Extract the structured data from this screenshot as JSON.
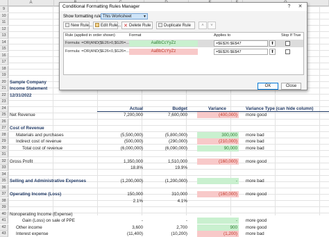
{
  "sheet": {
    "columns": [
      "A",
      "B",
      "C",
      "D",
      "E",
      "F",
      "G"
    ],
    "rows": [
      {
        "num": "9",
        "cells": []
      },
      {
        "num": "10",
        "cells": []
      },
      {
        "num": "11",
        "cells": []
      },
      {
        "num": "12",
        "cells": []
      },
      {
        "num": "13",
        "cells": []
      },
      {
        "num": "14",
        "cells": []
      },
      {
        "num": "15",
        "cells": []
      },
      {
        "num": "16",
        "cells": []
      },
      {
        "num": "17",
        "cells": []
      },
      {
        "num": "18",
        "cells": []
      },
      {
        "num": "19",
        "cells": []
      },
      {
        "num": "20",
        "cells": [
          {
            "text": "Sample Company",
            "bold": true
          }
        ]
      },
      {
        "num": "21",
        "cells": [
          {
            "text": "Income Statement",
            "bold": true
          }
        ]
      },
      {
        "num": "22",
        "cells": [
          {
            "text": "12/31/2022",
            "bold": true
          }
        ]
      },
      {
        "num": "23",
        "cells": []
      },
      {
        "num": "24",
        "cells": [
          {
            "col": "actual",
            "text": "Actual",
            "head": true
          },
          {
            "col": "budget",
            "text": "Budget",
            "head": true
          },
          {
            "col": "variance",
            "text": "Variance",
            "head": true
          },
          {
            "col": "vtype",
            "text": "Variance Type (can hide column)",
            "head": true
          }
        ]
      },
      {
        "num": "25",
        "cells": [
          {
            "text": "Net Revenue"
          },
          {
            "col": "actual",
            "text": "7,200,000"
          },
          {
            "col": "budget",
            "text": "7,600,000"
          },
          {
            "col": "variance",
            "text": "(400,000)",
            "fill": "red"
          },
          {
            "col": "vtype",
            "text": "more good"
          }
        ]
      },
      {
        "num": "26",
        "cells": []
      },
      {
        "num": "27",
        "cells": [
          {
            "text": "Cost of Revenue",
            "bold": true
          }
        ]
      },
      {
        "num": "28",
        "cells": [
          {
            "indent": 1,
            "text": "Materials and purchases"
          },
          {
            "col": "actual",
            "text": "(5,500,000)"
          },
          {
            "col": "budget",
            "text": "(5,800,000)"
          },
          {
            "col": "variance",
            "text": "300,000",
            "fill": "green"
          },
          {
            "col": "vtype",
            "text": "more bad"
          }
        ]
      },
      {
        "num": "29",
        "cells": [
          {
            "indent": 1,
            "text": "Indirect cost of revenue"
          },
          {
            "col": "actual",
            "text": "(500,000)"
          },
          {
            "col": "budget",
            "text": "(290,000)"
          },
          {
            "col": "variance",
            "text": "(210,000)",
            "fill": "red"
          },
          {
            "col": "vtype",
            "text": "more bad"
          }
        ]
      },
      {
        "num": "30",
        "cells": [
          {
            "indent": 2,
            "text": "Total cost of revenue"
          },
          {
            "col": "actual",
            "text": "(6,000,000)"
          },
          {
            "col": "budget",
            "text": "(6,090,000)"
          },
          {
            "col": "variance",
            "text": "90,000",
            "fill": "green"
          },
          {
            "col": "vtype",
            "text": "more bad"
          }
        ]
      },
      {
        "num": "31",
        "cells": []
      },
      {
        "num": "32",
        "cells": [
          {
            "text": "Gross Profit"
          },
          {
            "col": "actual",
            "text": "1,350,000"
          },
          {
            "col": "budget",
            "text": "1,510,000"
          },
          {
            "col": "variance",
            "text": "(160,000)",
            "fill": "red"
          },
          {
            "col": "vtype",
            "text": "more good"
          }
        ]
      },
      {
        "num": "33",
        "cells": [
          {
            "col": "actual",
            "text": "18.8%"
          },
          {
            "col": "budget",
            "text": "19.9%"
          }
        ]
      },
      {
        "num": "34",
        "cells": []
      },
      {
        "num": "35",
        "cells": [
          {
            "text": "Selling and Administrative Expenses",
            "bold": true
          },
          {
            "col": "actual",
            "text": "(1,200,000)"
          },
          {
            "col": "budget",
            "text": "(1,200,000)"
          },
          {
            "col": "variance",
            "text": "-",
            "fill": "green"
          },
          {
            "col": "vtype",
            "text": "more bad"
          }
        ]
      },
      {
        "num": "36",
        "cells": []
      },
      {
        "num": "37",
        "cells": [
          {
            "text": "Operating Income (Loss)",
            "bold": true
          },
          {
            "col": "actual",
            "text": "150,000"
          },
          {
            "col": "budget",
            "text": "310,000"
          },
          {
            "col": "variance",
            "text": "(160,000)",
            "fill": "red"
          },
          {
            "col": "vtype",
            "text": "more good"
          }
        ]
      },
      {
        "num": "38",
        "cells": [
          {
            "col": "actual",
            "text": "2.1%"
          },
          {
            "col": "budget",
            "text": "4.1%"
          }
        ]
      },
      {
        "num": "39",
        "cells": []
      },
      {
        "num": "40",
        "cells": [
          {
            "text": "Nonoperating Income (Expense)"
          }
        ]
      },
      {
        "num": "41",
        "cells": [
          {
            "indent": 2,
            "text": "Gain (Loss) on sale of PPE"
          },
          {
            "col": "actual",
            "text": "-"
          },
          {
            "col": "budget",
            "text": "-"
          },
          {
            "col": "variance",
            "text": "-",
            "fill": "green"
          },
          {
            "col": "vtype",
            "text": "more good"
          }
        ]
      },
      {
        "num": "42",
        "cells": [
          {
            "indent": 1,
            "text": "Other income"
          },
          {
            "col": "actual",
            "text": "3,600"
          },
          {
            "col": "budget",
            "text": "2,700"
          },
          {
            "col": "variance",
            "text": "900",
            "fill": "green"
          },
          {
            "col": "vtype",
            "text": "more good"
          }
        ]
      },
      {
        "num": "43",
        "cells": [
          {
            "indent": 1,
            "text": "Interest expense"
          },
          {
            "col": "actual",
            "text": "(11,400)"
          },
          {
            "col": "budget",
            "text": "(10,200)"
          },
          {
            "col": "variance",
            "text": "(1,200)",
            "fill": "red"
          },
          {
            "col": "vtype",
            "text": "more bad"
          }
        ]
      }
    ]
  },
  "dialog": {
    "title": "Conditional Formatting Rules Manager",
    "help": "?",
    "close": "✕",
    "show_label": "Show formatting rules for:",
    "show_value": "This Worksheet",
    "toolbar": {
      "new_rule": "New Rule...",
      "edit_rule": "Edit Rule...",
      "delete_rule": "Delete Rule",
      "duplicate_rule": "Duplicate Rule",
      "move_up": "˄",
      "move_down": "˅"
    },
    "headers": {
      "rule": "Rule (applied in order shown)",
      "format": "Format",
      "applies": "Applies to",
      "stop": "Stop If True"
    },
    "rules": [
      {
        "formula": "Formula: =OR(AND($E26>0,$G26=...",
        "preview": "AaBbCcYyZz",
        "fill": "green",
        "applies_to": "=$E$26:$E$47",
        "selected": true
      },
      {
        "formula": "Formula: =OR(AND($E26<0,$G26=...",
        "preview": "AaBbCcYyZz",
        "fill": "red",
        "applies_to": "=$E$26:$E$47",
        "selected": false
      }
    ],
    "ok": "OK",
    "close_btn": "Close",
    "apply": "Apply"
  }
}
